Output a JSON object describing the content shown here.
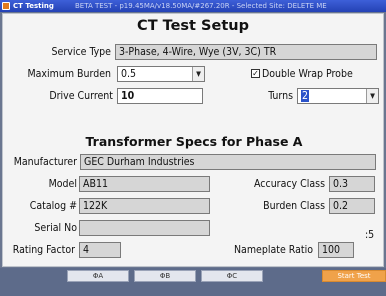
{
  "titlebar": {
    "app_title": "CT Testing",
    "status": "BETA TEST - p19.45MA/v18.50MA/#267.20R - Selected Site: DELETE ME"
  },
  "setup": {
    "title": "CT Test Setup",
    "service_type": {
      "label": "Service Type",
      "value": "3-Phase, 4-Wire, Wye (3V, 3C) TR"
    },
    "maximum_burden": {
      "label": "Maximum Burden",
      "value": "0.5"
    },
    "double_wrap": {
      "label": "Double Wrap Probe",
      "checked": true
    },
    "drive_current": {
      "label": "Drive Current",
      "value": "10"
    },
    "turns": {
      "label": "Turns",
      "value": "2"
    }
  },
  "specs": {
    "title": "Transformer Specs for Phase A",
    "manufacturer": {
      "label": "Manufacturer",
      "value": "GEC Durham Industries"
    },
    "model": {
      "label": "Model",
      "value": "AB11"
    },
    "catalog": {
      "label": "Catalog #",
      "value": "122K"
    },
    "serial": {
      "label": "Serial No",
      "value": ""
    },
    "rating_factor": {
      "label": "Rating Factor",
      "value": "4"
    },
    "accuracy_class": {
      "label": "Accuracy Class",
      "value": "0.3"
    },
    "burden_class": {
      "label": "Burden Class",
      "value": "0.2"
    },
    "ratio_suffix": ":5",
    "nameplate_ratio": {
      "label": "Nameplate Ratio",
      "value": "100"
    }
  },
  "bottom": {
    "tabs": [
      "ΦA",
      "ΦB",
      "ΦC"
    ],
    "start_label": "Start Test"
  },
  "colors": {
    "accent": "#f0a24a",
    "titlebar": "#2f4fc8",
    "field": "#d6d6d6"
  }
}
